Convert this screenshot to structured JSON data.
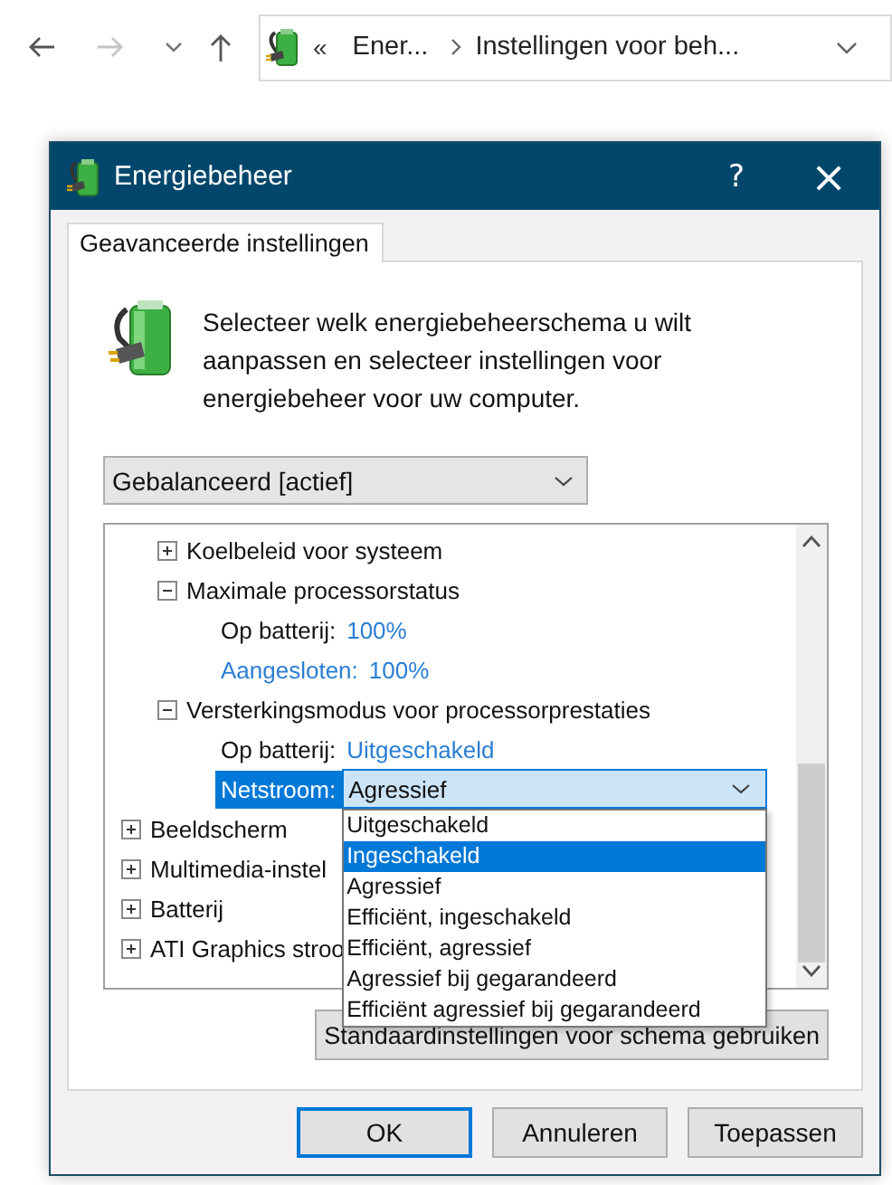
{
  "explorer": {
    "address": {
      "overflow": "«",
      "crumbs": [
        "Ener...",
        "Instellingen voor beh..."
      ]
    },
    "forward_disabled": true
  },
  "dialog": {
    "title": "Energiebeheer",
    "help": "?",
    "close": "×",
    "tabs": [
      {
        "label": "Geavanceerde instellingen",
        "selected": true
      }
    ],
    "intro": "Selecteer welk energiebeheerschema u wilt aanpassen en selecteer instellingen voor energiebeheer voor uw computer.",
    "scheme": {
      "value": "Gebalanceerd [actief]"
    },
    "tree": {
      "items": [
        {
          "kind": "hidden",
          "children": [
            {
              "kind": "group",
              "label": "Koelbeleid voor systeem",
              "expanded": false
            },
            {
              "kind": "group",
              "label": "Maximale processorstatus",
              "expanded": true,
              "children": [
                {
                  "kind": "setting",
                  "label": "Op batterij:",
                  "value": "100%",
                  "hover": false,
                  "selected": false
                },
                {
                  "kind": "setting",
                  "label": "Aangesloten:",
                  "value": "100%",
                  "hover": true,
                  "selected": false
                }
              ]
            },
            {
              "kind": "group",
              "label": "Versterkingsmodus voor processorprestaties",
              "expanded": true,
              "children": [
                {
                  "kind": "setting",
                  "label": "Op batterij:",
                  "value": "Uitgeschakeld",
                  "hover": false,
                  "selected": false
                },
                {
                  "kind": "setting",
                  "label": "Netstroom:",
                  "value": "Agressief",
                  "selected": true,
                  "options": [
                    {
                      "label": "Uitgeschakeld",
                      "highlighted": false
                    },
                    {
                      "label": "Ingeschakeld",
                      "highlighted": true
                    },
                    {
                      "label": "Agressief",
                      "highlighted": false
                    },
                    {
                      "label": "Efficiënt, ingeschakeld",
                      "highlighted": false
                    },
                    {
                      "label": "Efficiënt, agressief",
                      "highlighted": false
                    },
                    {
                      "label": "Agressief bij gegarandeerd",
                      "highlighted": false
                    },
                    {
                      "label": "Efficiënt agressief bij gegarandeerd",
                      "highlighted": false
                    }
                  ]
                }
              ]
            }
          ]
        },
        {
          "kind": "group",
          "label": "Beeldscherm",
          "expanded": false
        },
        {
          "kind": "group",
          "label": "Multimedia-instel",
          "expanded": false
        },
        {
          "kind": "group",
          "label": "Batterij",
          "expanded": false
        },
        {
          "kind": "group",
          "label": "ATI Graphics stroo",
          "expanded": false
        }
      ]
    },
    "restore_button": "Standaardinstellingen voor schema gebruiken",
    "buttons": [
      {
        "label": "OK",
        "default": true
      },
      {
        "label": "Annuleren",
        "default": false
      },
      {
        "label": "Toepassen",
        "default": false
      }
    ]
  }
}
